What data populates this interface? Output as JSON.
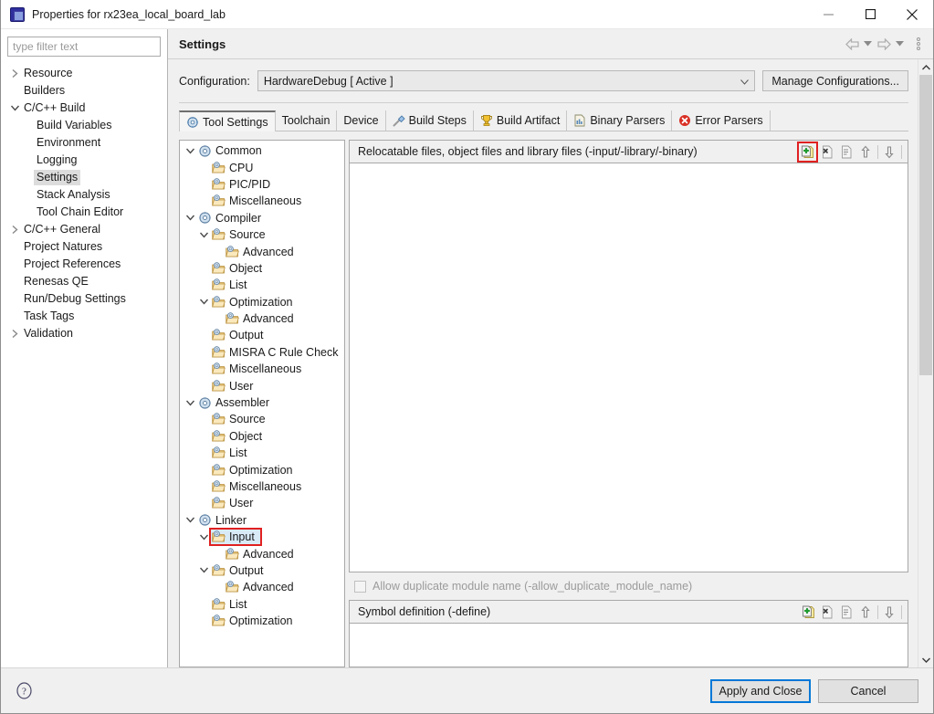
{
  "window": {
    "title": "Properties for rx23ea_local_board_lab",
    "app_icon": "eclipse-properties-icon",
    "controls": {
      "minimize": "minimize-icon",
      "maximize": "maximize-icon",
      "close": "close-icon"
    }
  },
  "filter": {
    "placeholder": "type filter text",
    "value": ""
  },
  "sidebar": {
    "items": [
      {
        "label": "Resource",
        "indent": 0,
        "arrow": "collapsed",
        "selected": false
      },
      {
        "label": "Builders",
        "indent": 0,
        "arrow": "none",
        "selected": false
      },
      {
        "label": "C/C++ Build",
        "indent": 0,
        "arrow": "expanded",
        "selected": false
      },
      {
        "label": "Build Variables",
        "indent": 1,
        "arrow": "none",
        "selected": false
      },
      {
        "label": "Environment",
        "indent": 1,
        "arrow": "none",
        "selected": false
      },
      {
        "label": "Logging",
        "indent": 1,
        "arrow": "none",
        "selected": false
      },
      {
        "label": "Settings",
        "indent": 1,
        "arrow": "none",
        "selected": true
      },
      {
        "label": "Stack Analysis",
        "indent": 1,
        "arrow": "none",
        "selected": false
      },
      {
        "label": "Tool Chain Editor",
        "indent": 1,
        "arrow": "none",
        "selected": false
      },
      {
        "label": "C/C++ General",
        "indent": 0,
        "arrow": "collapsed",
        "selected": false
      },
      {
        "label": "Project Natures",
        "indent": 0,
        "arrow": "none",
        "selected": false
      },
      {
        "label": "Project References",
        "indent": 0,
        "arrow": "none",
        "selected": false
      },
      {
        "label": "Renesas QE",
        "indent": 0,
        "arrow": "none",
        "selected": false
      },
      {
        "label": "Run/Debug Settings",
        "indent": 0,
        "arrow": "none",
        "selected": false
      },
      {
        "label": "Task Tags",
        "indent": 0,
        "arrow": "none",
        "selected": false
      },
      {
        "label": "Validation",
        "indent": 0,
        "arrow": "collapsed",
        "selected": false
      }
    ]
  },
  "pane": {
    "title": "Settings",
    "header_icons": {
      "back": "back-arrow-icon",
      "back_menu": "chevron-down-icon",
      "forward": "forward-arrow-icon",
      "forward_menu": "chevron-down-icon",
      "view_menu": "view-menu-icon"
    }
  },
  "configuration": {
    "label": "Configuration:",
    "value": "HardwareDebug  [ Active ]",
    "manage_label": "Manage Configurations..."
  },
  "tabs": [
    {
      "label": "Tool Settings",
      "icon": "tool-settings-icon",
      "active": true
    },
    {
      "label": "Toolchain",
      "icon": "none",
      "active": false
    },
    {
      "label": "Device",
      "icon": "none",
      "active": false
    },
    {
      "label": "Build Steps",
      "icon": "hammer-icon",
      "active": false
    },
    {
      "label": "Build Artifact",
      "icon": "trophy-icon",
      "active": false
    },
    {
      "label": "Binary Parsers",
      "icon": "document-icon",
      "active": false
    },
    {
      "label": "Error Parsers",
      "icon": "error-icon",
      "active": false
    }
  ],
  "tool_tree": [
    {
      "label": "Common",
      "level": 0,
      "arrow": "expanded",
      "icon": "tool-icon",
      "selected": false
    },
    {
      "label": "CPU",
      "level": 1,
      "arrow": "none",
      "icon": "folder-icon",
      "selected": false
    },
    {
      "label": "PIC/PID",
      "level": 1,
      "arrow": "none",
      "icon": "folder-icon",
      "selected": false
    },
    {
      "label": "Miscellaneous",
      "level": 1,
      "arrow": "none",
      "icon": "folder-icon",
      "selected": false
    },
    {
      "label": "Compiler",
      "level": 0,
      "arrow": "expanded",
      "icon": "tool-icon",
      "selected": false
    },
    {
      "label": "Source",
      "level": 1,
      "arrow": "expanded",
      "icon": "folder-icon",
      "selected": false
    },
    {
      "label": "Advanced",
      "level": 2,
      "arrow": "none",
      "icon": "folder-icon",
      "selected": false
    },
    {
      "label": "Object",
      "level": 1,
      "arrow": "none",
      "icon": "folder-icon",
      "selected": false
    },
    {
      "label": "List",
      "level": 1,
      "arrow": "none",
      "icon": "folder-icon",
      "selected": false
    },
    {
      "label": "Optimization",
      "level": 1,
      "arrow": "expanded",
      "icon": "folder-icon",
      "selected": false
    },
    {
      "label": "Advanced",
      "level": 2,
      "arrow": "none",
      "icon": "folder-icon",
      "selected": false
    },
    {
      "label": "Output",
      "level": 1,
      "arrow": "none",
      "icon": "folder-icon",
      "selected": false
    },
    {
      "label": "MISRA C Rule Check",
      "level": 1,
      "arrow": "none",
      "icon": "folder-icon",
      "selected": false
    },
    {
      "label": "Miscellaneous",
      "level": 1,
      "arrow": "none",
      "icon": "folder-icon",
      "selected": false
    },
    {
      "label": "User",
      "level": 1,
      "arrow": "none",
      "icon": "folder-icon",
      "selected": false
    },
    {
      "label": "Assembler",
      "level": 0,
      "arrow": "expanded",
      "icon": "tool-icon",
      "selected": false
    },
    {
      "label": "Source",
      "level": 1,
      "arrow": "none",
      "icon": "folder-icon",
      "selected": false
    },
    {
      "label": "Object",
      "level": 1,
      "arrow": "none",
      "icon": "folder-icon",
      "selected": false
    },
    {
      "label": "List",
      "level": 1,
      "arrow": "none",
      "icon": "folder-icon",
      "selected": false
    },
    {
      "label": "Optimization",
      "level": 1,
      "arrow": "none",
      "icon": "folder-icon",
      "selected": false
    },
    {
      "label": "Miscellaneous",
      "level": 1,
      "arrow": "none",
      "icon": "folder-icon",
      "selected": false
    },
    {
      "label": "User",
      "level": 1,
      "arrow": "none",
      "icon": "folder-icon",
      "selected": false
    },
    {
      "label": "Linker",
      "level": 0,
      "arrow": "expanded",
      "icon": "tool-icon",
      "selected": false
    },
    {
      "label": "Input",
      "level": 1,
      "arrow": "expanded",
      "icon": "folder-icon",
      "selected": true
    },
    {
      "label": "Advanced",
      "level": 2,
      "arrow": "none",
      "icon": "folder-icon",
      "selected": false
    },
    {
      "label": "Output",
      "level": 1,
      "arrow": "expanded",
      "icon": "folder-icon",
      "selected": false
    },
    {
      "label": "Advanced",
      "level": 2,
      "arrow": "none",
      "icon": "folder-icon",
      "selected": false
    },
    {
      "label": "List",
      "level": 1,
      "arrow": "none",
      "icon": "folder-icon",
      "selected": false
    },
    {
      "label": "Optimization",
      "level": 1,
      "arrow": "none",
      "icon": "folder-icon",
      "selected": false
    }
  ],
  "input_panel": {
    "relocatable": {
      "title": "Relocatable files, object files and library files (-input/-library/-binary)",
      "items": [],
      "toolbar": [
        {
          "name": "add-icon",
          "highlighted": true
        },
        {
          "name": "delete-icon",
          "highlighted": false
        },
        {
          "name": "edit-icon",
          "highlighted": false
        },
        {
          "name": "move-up-icon",
          "highlighted": false
        },
        {
          "name": "move-down-icon",
          "highlighted": false
        }
      ]
    },
    "allow_duplicate": {
      "label": "Allow duplicate module name (-allow_duplicate_module_name)",
      "checked": false,
      "enabled": false
    },
    "symbol_definition": {
      "title": "Symbol definition (-define)",
      "items": [],
      "toolbar": [
        {
          "name": "add-icon",
          "highlighted": false
        },
        {
          "name": "delete-icon",
          "highlighted": false
        },
        {
          "name": "edit-icon",
          "highlighted": false
        },
        {
          "name": "move-up-icon",
          "highlighted": false
        },
        {
          "name": "move-down-icon",
          "highlighted": false
        }
      ]
    }
  },
  "footer": {
    "help_icon": "help-icon",
    "apply_and_close": "Apply and Close",
    "cancel": "Cancel"
  },
  "colors": {
    "highlight_red": "#e02020",
    "selection_blue": "#d9eaf7",
    "focus_blue": "#0078d7",
    "window_bg": "#f0f0f0"
  }
}
